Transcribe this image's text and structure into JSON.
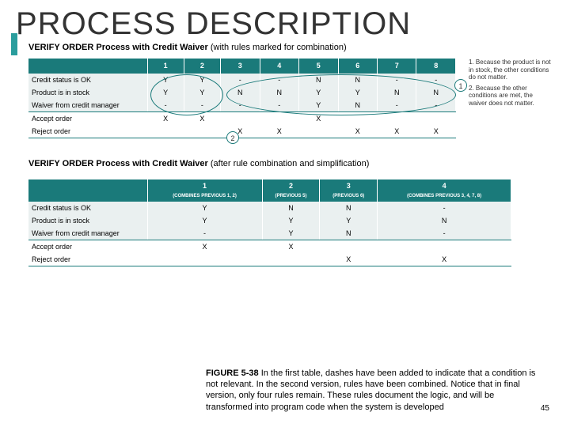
{
  "bg_title": "PROCESS DESCRIPTION",
  "table1": {
    "title_bold": "VERIFY ORDER Process with Credit Waiver",
    "title_light": " (with rules marked for combination)",
    "cols": [
      "1",
      "2",
      "3",
      "4",
      "5",
      "6",
      "7",
      "8"
    ],
    "rows": [
      {
        "label": "Credit status is OK",
        "v": [
          "Y",
          "Y",
          "-",
          "-",
          "N",
          "N",
          "-",
          "-"
        ]
      },
      {
        "label": "Product is in stock",
        "v": [
          "Y",
          "Y",
          "N",
          "N",
          "Y",
          "Y",
          "N",
          "N"
        ]
      },
      {
        "label": "Waiver from credit manager",
        "v": [
          "-",
          "-",
          "-",
          "-",
          "Y",
          "N",
          "-",
          "-"
        ]
      }
    ],
    "actions": [
      {
        "label": "Accept order",
        "v": [
          "X",
          "X",
          "",
          "",
          "X",
          "",
          "",
          ""
        ]
      },
      {
        "label": "Reject order",
        "v": [
          "",
          "",
          "X",
          "X",
          "",
          "X",
          "X",
          "X"
        ]
      }
    ],
    "notes": {
      "n1": "Because the product is not in stock, the other conditions do not matter.",
      "n2": "Because the other conditions are met, the waiver does not matter."
    },
    "m1": "1",
    "m2": "2"
  },
  "table2": {
    "title_bold": "VERIFY ORDER Process with Credit Waiver",
    "title_light": " (after rule combination and simplification)",
    "cols": [
      "1",
      "2",
      "3",
      "4"
    ],
    "subs": [
      "(COMBINES PREVIOUS 1, 2)",
      "(PREVIOUS 5)",
      "(PREVIOUS 6)",
      "(COMBINES PREVIOUS 3, 4, 7, 8)"
    ],
    "rows": [
      {
        "label": "Credit status is OK",
        "v": [
          "Y",
          "N",
          "N",
          "-"
        ]
      },
      {
        "label": "Product is in stock",
        "v": [
          "Y",
          "Y",
          "Y",
          "N"
        ]
      },
      {
        "label": "Waiver from credit manager",
        "v": [
          "-",
          "Y",
          "N",
          "-"
        ]
      }
    ],
    "actions": [
      {
        "label": "Accept order",
        "v": [
          "X",
          "X",
          "",
          ""
        ]
      },
      {
        "label": "Reject order",
        "v": [
          "",
          "",
          "X",
          "X"
        ]
      }
    ]
  },
  "caption": {
    "fig": "FIGURE 5-38",
    "text": " In the first table, dashes have been added to indicate that a condition is not relevant. In the second version, rules have been combined. Notice that in final version, only four rules remain. These rules document the logic, and will be transformed into program code when the system is developed"
  },
  "pagenum": "45"
}
